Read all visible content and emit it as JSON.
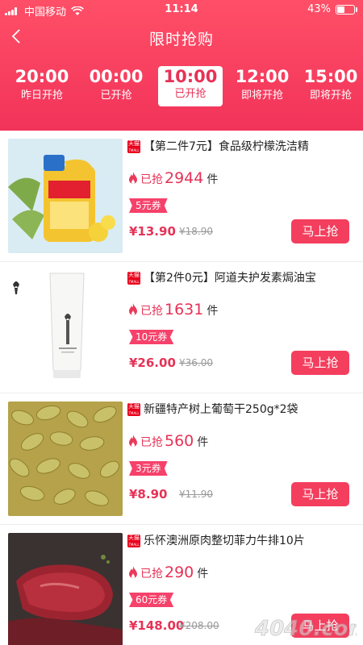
{
  "status_bar": {
    "carrier": "中国移动",
    "time": "11:14",
    "battery": "43%",
    "battery_level": 0.43
  },
  "nav": {
    "title": "限时抢购"
  },
  "tabs": [
    {
      "time": "20:00",
      "status": "昨日开抢"
    },
    {
      "time": "00:00",
      "status": "已开抢"
    },
    {
      "time": "10:00",
      "status": "已开抢",
      "active": true
    },
    {
      "time": "12:00",
      "status": "即将开抢"
    },
    {
      "time": "15:00",
      "status": "即将开抢"
    }
  ],
  "products": [
    {
      "name": "【第二件7元】食品级柠檬洗洁精",
      "sold_prefix": "已抢",
      "sold": "2944",
      "unit": "件",
      "coupon": "5元券",
      "price": "¥13.90",
      "original_price": "¥18.90",
      "buy_label": "马上抢"
    },
    {
      "name": "【第2件0元】阿道夫护发素焗油宝",
      "sold_prefix": "已抢",
      "sold": "1631",
      "unit": "件",
      "coupon": "10元券",
      "price": "¥26.00",
      "original_price": "¥36.00",
      "buy_label": "马上抢"
    },
    {
      "name": "新疆特产树上葡萄干250g*2袋",
      "sold_prefix": "已抢",
      "sold": "560",
      "unit": "件",
      "coupon": "3元券",
      "price": "¥8.90",
      "original_price": "¥11.90",
      "buy_label": "马上抢"
    },
    {
      "name": "乐怀澳洲原肉整切菲力牛排10片",
      "sold_prefix": "已抢",
      "sold": "290",
      "unit": "件",
      "coupon": "60元券",
      "price": "¥148.00",
      "original_price": "¥208.00",
      "buy_label": "马上抢"
    }
  ],
  "badge": {
    "line1": "天猫",
    "line2": "TMALL"
  },
  "watermark": "4040.com",
  "colors": {
    "accent": "#f2335a",
    "button": "#f43e5e",
    "coupon": "#f6416a"
  }
}
